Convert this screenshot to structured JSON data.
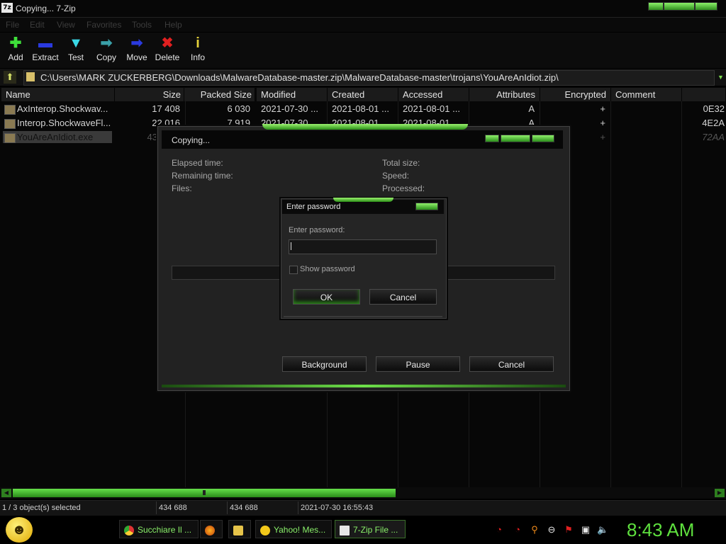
{
  "window": {
    "title": "Copying... 7-Zip",
    "app_icon": "7z"
  },
  "menu": [
    "File",
    "Edit",
    "View",
    "Favorites",
    "Tools",
    "Help"
  ],
  "toolbar": [
    {
      "label": "Add",
      "icon": "plus-icon",
      "glyph": "✚",
      "color": "#3ee03a"
    },
    {
      "label": "Extract",
      "icon": "minus-icon",
      "glyph": "▬",
      "color": "#2a3adf"
    },
    {
      "label": "Test",
      "icon": "check-icon",
      "glyph": "▼",
      "color": "#3ad8e6"
    },
    {
      "label": "Copy",
      "icon": "copy-arrow-icon",
      "glyph": "➡",
      "color": "#3aa0a8"
    },
    {
      "label": "Move",
      "icon": "move-arrow-icon",
      "glyph": "➡",
      "color": "#2a3adf"
    },
    {
      "label": "Delete",
      "icon": "delete-x-icon",
      "glyph": "✖",
      "color": "#e02020"
    },
    {
      "label": "Info",
      "icon": "info-icon",
      "glyph": "i",
      "color": "#e6d23a"
    }
  ],
  "address": {
    "path": "C:\\Users\\MARK ZUCKERBERG\\Downloads\\MalwareDatabase-master.zip\\MalwareDatabase-master\\trojans\\YouAreAnIdiot.zip\\"
  },
  "columns": [
    "Name",
    "Size",
    "Packed Size",
    "Modified",
    "Created",
    "Accessed",
    "Attributes",
    "Encrypted",
    "Comment",
    ""
  ],
  "files": [
    {
      "name": "AxInterop.Shockwav...",
      "size": "17 408",
      "packed": "6 030",
      "modified": "2021-07-30 ...",
      "created": "2021-08-01 ...",
      "accessed": "2021-08-01 ...",
      "attributes": "A",
      "encrypted": "+",
      "crc": "0E32"
    },
    {
      "name": "Interop.ShockwaveFl...",
      "size": "22 016",
      "packed": "7 919",
      "modified": "2021-07-30 ...",
      "created": "2021-08-01 ...",
      "accessed": "2021-08-01 ...",
      "attributes": "A",
      "encrypted": "+",
      "crc": "4E2A"
    },
    {
      "name": "YouAreAnIdiot.exe",
      "size": "43",
      "packed": "",
      "modified": "",
      "created": "",
      "accessed": "",
      "attributes": "",
      "encrypted": "+",
      "crc": "72AA"
    }
  ],
  "status": {
    "selected": "1 / 3 object(s) selected",
    "size": "434 688",
    "packed": "434 688",
    "modified": "2021-07-30 16:55:43"
  },
  "copy_dialog": {
    "title": "Copying...",
    "elapsed_label": "Elapsed time:",
    "remaining_label": "Remaining time:",
    "files_label": "Files:",
    "total_size_label": "Total size:",
    "speed_label": "Speed:",
    "processed_label": "Processed:",
    "background_button": "Background",
    "pause_button": "Pause",
    "cancel_button": "Cancel"
  },
  "password_dialog": {
    "title": "Enter password",
    "prompt": "Enter password:",
    "value": "",
    "show_password_label": "Show password",
    "show_password_checked": false,
    "ok_button": "OK",
    "cancel_button": "Cancel"
  },
  "taskbar": {
    "start_icon": "smiley-icon",
    "tasks": [
      {
        "label": "Succhiare Il ...",
        "icon": "chrome-icon"
      },
      {
        "label": "",
        "icon": "firefox-icon"
      },
      {
        "label": "",
        "icon": "folder-icon"
      },
      {
        "label": "Yahoo! Mes...",
        "icon": "yahoo-messenger-icon"
      },
      {
        "label": "7-Zip File ...",
        "icon": "7zip-icon"
      }
    ],
    "clock": "8:43 AM"
  },
  "colors": {
    "accent": "#5ee03e",
    "background": "#000000"
  }
}
